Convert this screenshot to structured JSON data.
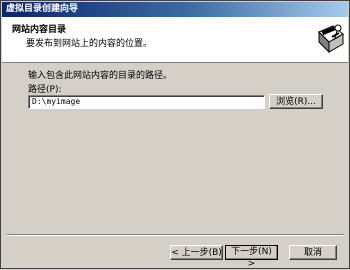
{
  "window": {
    "title": "虚拟目录创建向导"
  },
  "header": {
    "title": "网站内容目录",
    "subtitle": "要发布到网站上的内容的位置。",
    "icon": "wizard-computer-icon"
  },
  "main": {
    "instruction": "输入包含此网站内容的目录的路径。",
    "path_label": "路径",
    "path_accel": "(P):",
    "path_value": "D:\\myimage",
    "browse_label": "浏览(R)..."
  },
  "footer": {
    "back_label": "< 上一步(B)",
    "next_label": "下一步(N) >",
    "cancel_label": "取消"
  }
}
